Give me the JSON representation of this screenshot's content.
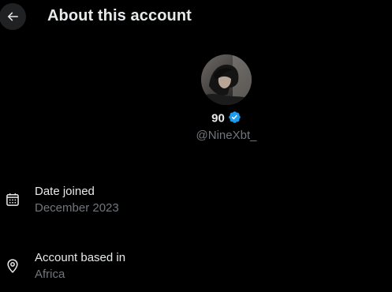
{
  "header": {
    "title": "About this account",
    "back_icon": "arrow-left-icon"
  },
  "profile": {
    "display_name": "90",
    "verified": true,
    "verified_icon": "verified-badge-icon",
    "handle": "@NineXbt_"
  },
  "details": [
    {
      "icon": "calendar-icon",
      "label": "Date joined",
      "value": "December 2023"
    },
    {
      "icon": "location-pin-icon",
      "label": "Account based in",
      "value": "Africa"
    }
  ],
  "colors": {
    "background": "#000000",
    "primary_text": "#e7e9ea",
    "secondary_text": "#71767b",
    "verified_blue": "#1d9bf0",
    "back_button_bg": "#1f2123"
  }
}
